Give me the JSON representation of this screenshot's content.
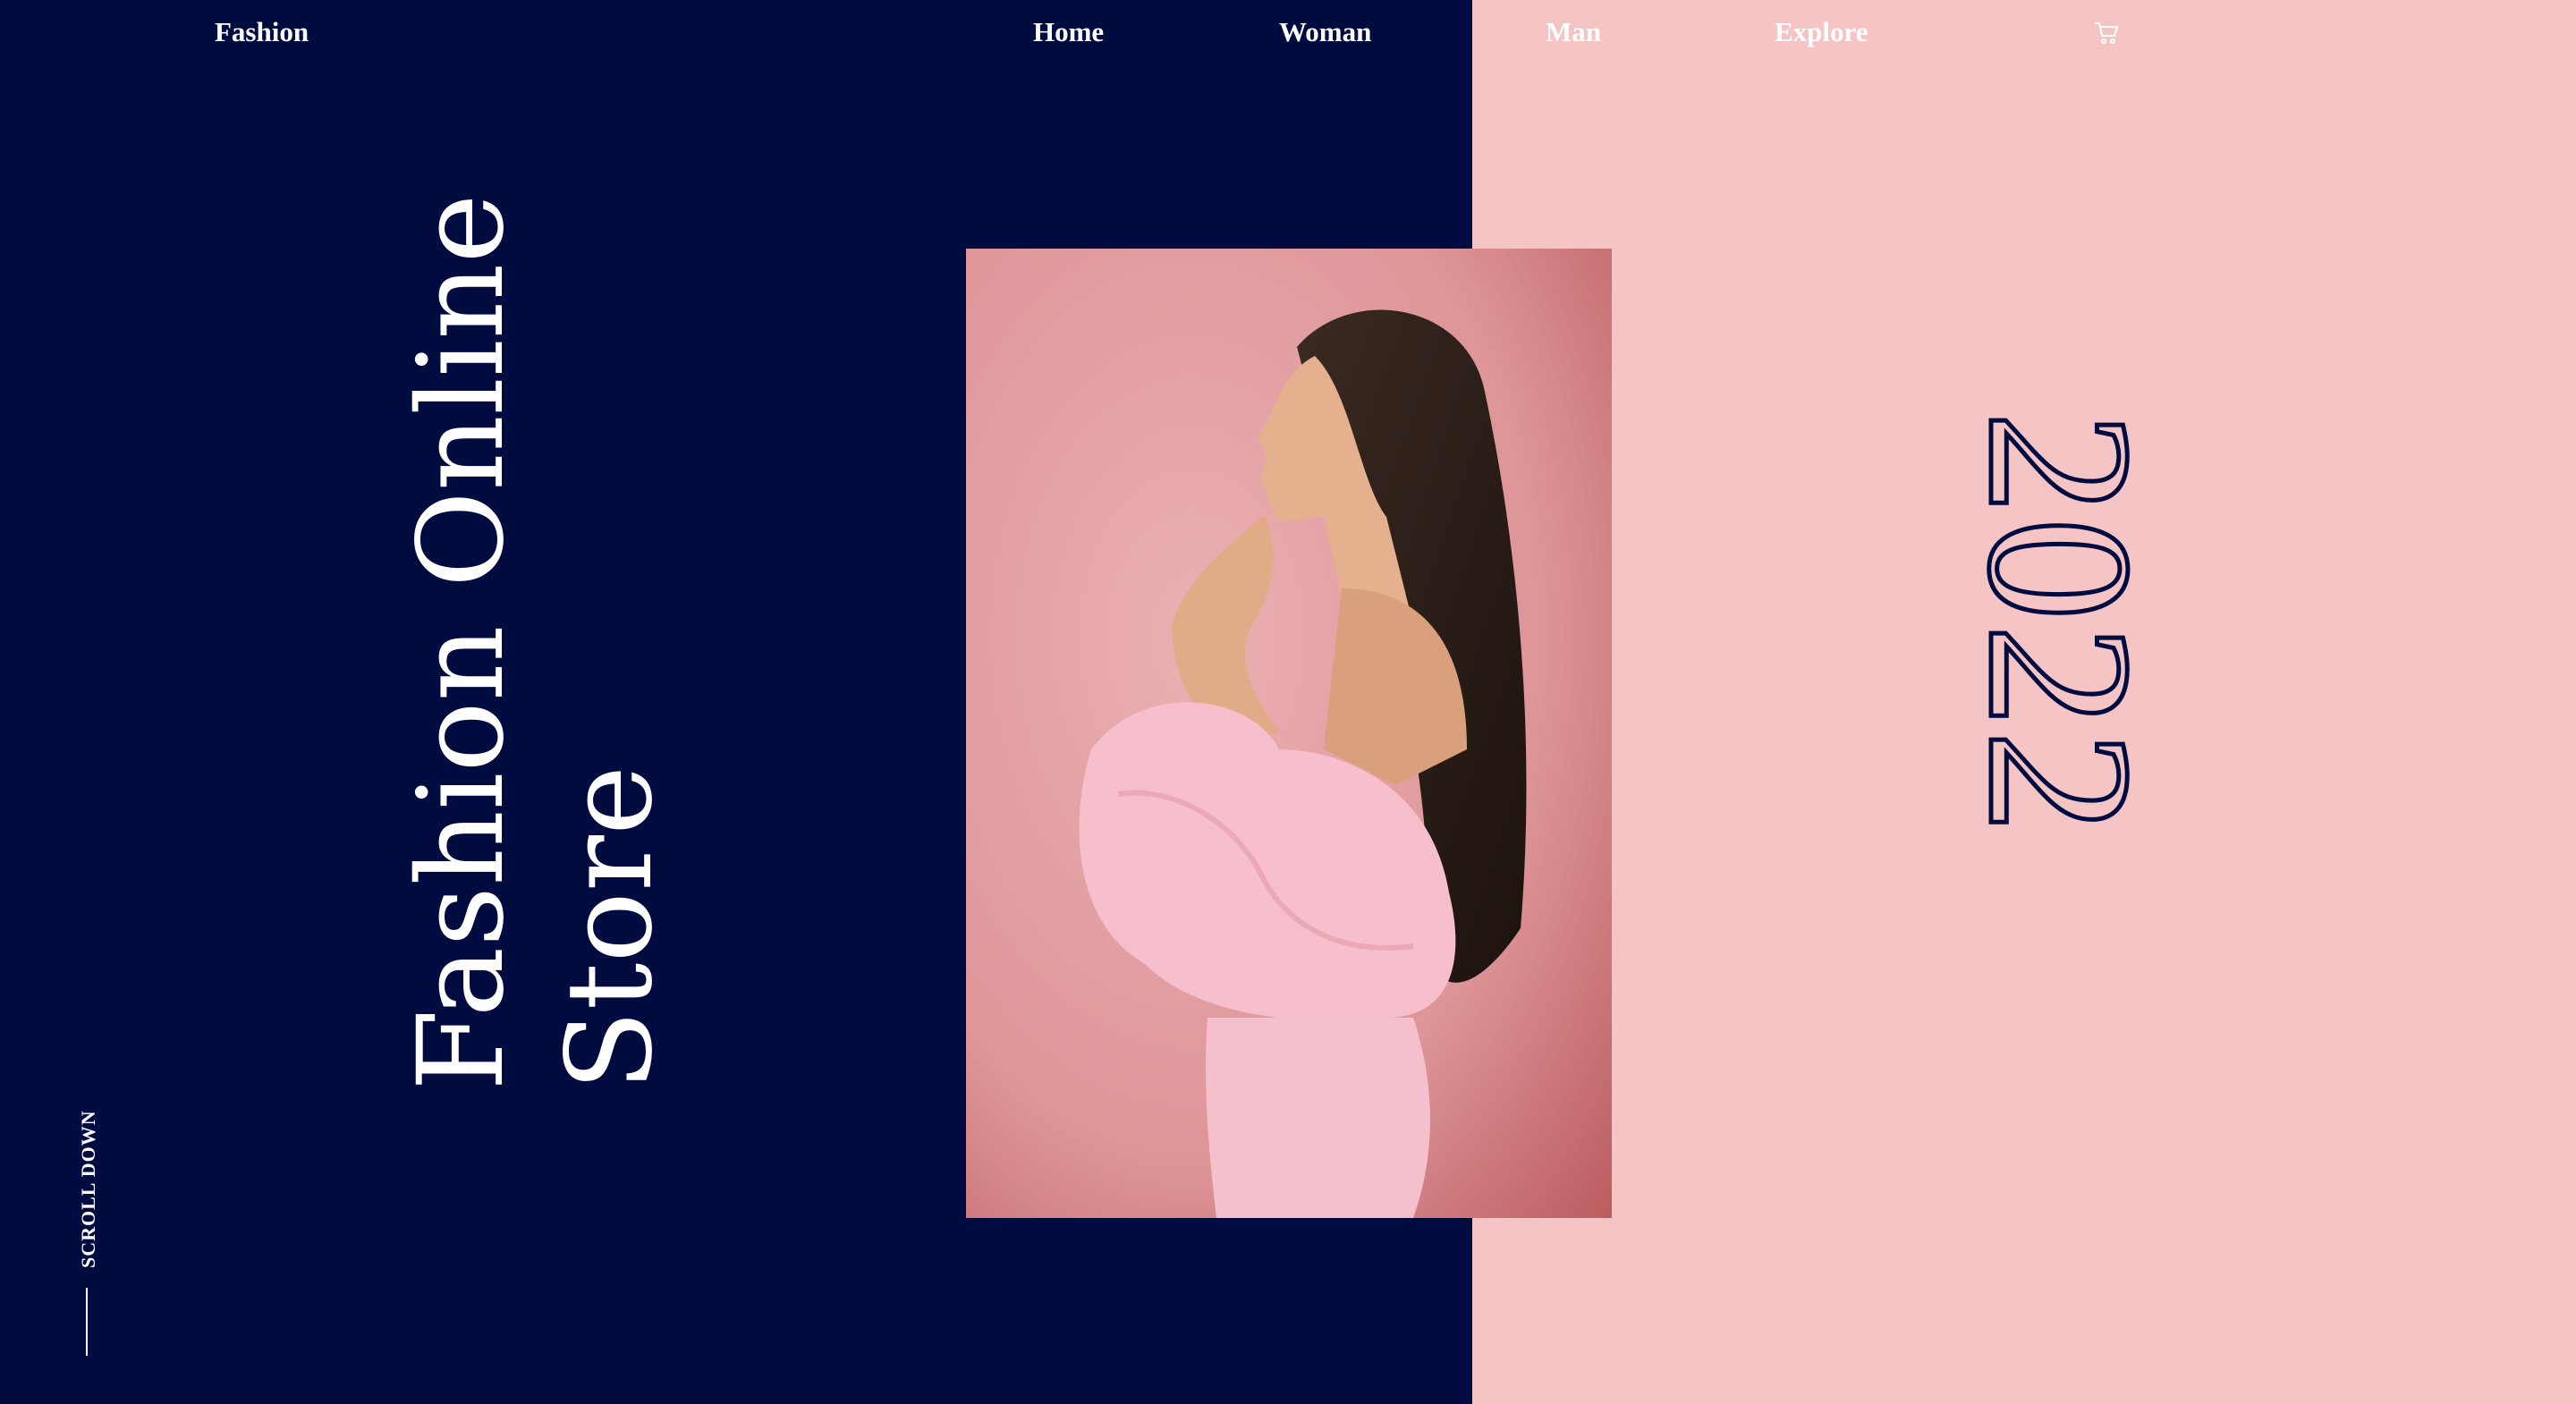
{
  "nav": {
    "brand": "Fashion",
    "links": [
      "Home",
      "Woman",
      "Man",
      "Explore"
    ],
    "cart_icon": "cart-icon"
  },
  "hero": {
    "headline_line1": "Fashion Online",
    "headline_line2": "Store",
    "year": "2022",
    "scroll_label": "SCROLL DOWN"
  },
  "colors": {
    "navy": "#000b3f",
    "pink_panel": "#f5c4c4",
    "photo_background": "#e39ea2",
    "dress": "#f7bfcb",
    "text_light": "#ffffff"
  }
}
